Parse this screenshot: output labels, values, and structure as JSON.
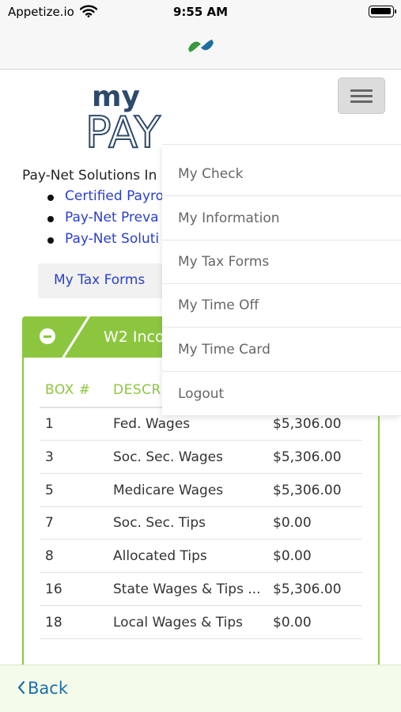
{
  "status": {
    "carrier": "Appetize.io",
    "time": "9:55 AM"
  },
  "logo": {
    "my": "my",
    "pay": "PAY"
  },
  "company": "Pay-Net Solutions In",
  "links": [
    {
      "label": "Certified Payro"
    },
    {
      "label": "Pay-Net Preva"
    },
    {
      "label": "Pay-Net Soluti"
    }
  ],
  "tax_tab": {
    "label": "My Tax Forms"
  },
  "panel": {
    "title": "W2 Inco"
  },
  "table": {
    "headers": {
      "box": "BOX #",
      "desc": "DESCR"
    },
    "rows": [
      {
        "box": "1",
        "desc": "Fed. Wages",
        "amount": "$5,306.00"
      },
      {
        "box": "3",
        "desc": "Soc. Sec. Wages",
        "amount": "$5,306.00"
      },
      {
        "box": "5",
        "desc": "Medicare Wages",
        "amount": "$5,306.00"
      },
      {
        "box": "7",
        "desc": "Soc. Sec. Tips",
        "amount": "$0.00"
      },
      {
        "box": "8",
        "desc": "Allocated Tips",
        "amount": "$0.00"
      },
      {
        "box": "16",
        "desc": "State Wages & Tips ...",
        "amount": "$5,306.00"
      },
      {
        "box": "18",
        "desc": "Local Wages & Tips",
        "amount": "$0.00"
      }
    ]
  },
  "menu": {
    "items": [
      {
        "label": "My Check"
      },
      {
        "label": "My Information"
      },
      {
        "label": "My Tax Forms"
      },
      {
        "label": "My Time Off"
      },
      {
        "label": "My Time Card"
      },
      {
        "label": "Logout"
      }
    ]
  },
  "back": {
    "label": "Back"
  },
  "colors": {
    "accent_green": "#8cc63f",
    "link_blue": "#2a3fd0",
    "logo_navy": "#2e4a6b"
  },
  "icons": [
    "wifi-icon",
    "battery-icon",
    "app-logo-icon",
    "hamburger-menu-icon",
    "collapse-minus-icon",
    "chevron-left-icon"
  ]
}
